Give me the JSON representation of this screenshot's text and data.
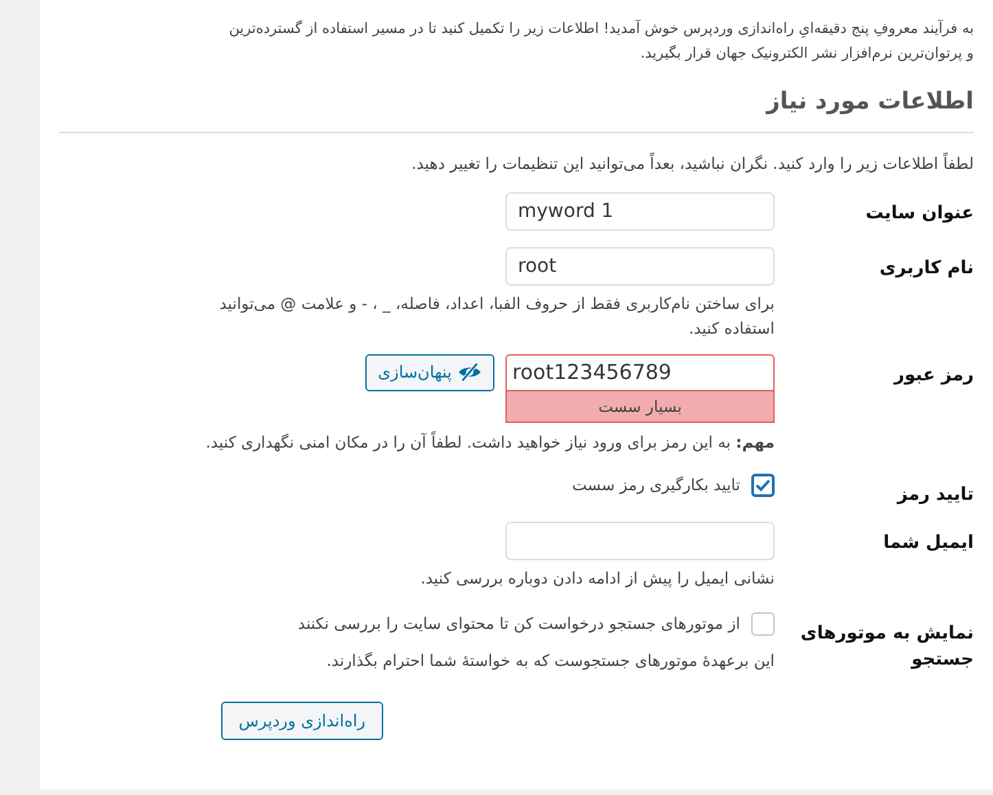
{
  "intro": [
    "به فرآیند معروفِ پنج دقیقه‌ایِ راه‌اندازی وردپرس خوش آمدید! اطلاعات زیر را تکمیل کنید تا در مسیر استفاده از گسترده‌ترین",
    "و پرتوان‌ترین نرم‌افزار نشر الکترونیک جهان قرار بگیرید."
  ],
  "heading": "اطلاعات مورد نیاز",
  "lead": "لطفاً اطلاعات زیر را وارد کنید. نگران نباشید، بعداً می‌توانید این تنظیمات را تغییر دهید.",
  "rows": [
    {
      "kind": "text",
      "label": "عنوان سایت",
      "value": "myword 1"
    },
    {
      "kind": "text",
      "label": "نام کاربری",
      "value": "root",
      "hint": "برای ساختن نام‌کاربری فقط از حروف الفبا، اعداد، فاصله، _ ، - و علامت @ می‌توانید استفاده کنید."
    },
    {
      "kind": "password",
      "label": "رمز عبور",
      "value": "root123456789",
      "toggle": "پنهان‌سازی",
      "strength": "بسیار سست",
      "note": "**مهم:** به این رمز برای ورود نیاز خواهید داشت. لطفاً آن را در مکان امنی نگهداری کنید."
    },
    {
      "kind": "checkbox",
      "label": "تایید رمز",
      "text": "تایید بکارگیری رمز سست",
      "checked": true
    },
    {
      "kind": "text",
      "label": "ایمیل شما",
      "value": "",
      "hint": "نشانی ایمیل را پیش از ادامه دادن دوباره بررسی کنید."
    },
    {
      "kind": "checkbox",
      "label": "نمایش به موتورهای جستجو",
      "text": "از موتورهای جستجو درخواست کن تا محتوای سایت را بررسی نکنند",
      "checked": false,
      "hint": "این برعهدهٔ موتورهای جستجوست که به خواستهٔ شما احترام بگذارند."
    }
  ],
  "submit": "راه‌اندازی وردپرس"
}
